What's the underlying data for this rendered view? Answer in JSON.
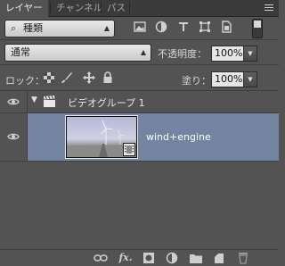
{
  "tabs": [
    {
      "label": "レイヤー",
      "active": true
    },
    {
      "label": "チャンネル",
      "active": false
    },
    {
      "label": "パス",
      "active": false
    }
  ],
  "filter": {
    "kind_label": "種類"
  },
  "blend": {
    "mode": "通常",
    "opacity_label": "不透明度：",
    "opacity_value": "100%"
  },
  "lock": {
    "label": "ロック：",
    "fill_label": "塗り：",
    "fill_value": "100%"
  },
  "layers": [
    {
      "type": "group",
      "name": "ビデオグループ 1",
      "visible": true,
      "expanded": true
    },
    {
      "type": "video",
      "name": "wind+engine",
      "visible": true,
      "selected": true
    }
  ],
  "colors": {
    "panel": "#535353",
    "selected_row": "#7385a1",
    "tabbar": "#3a3a3a"
  },
  "bottom_icons": [
    "link-layers-icon",
    "fx-icon",
    "layer-mask-icon",
    "adjustment-layer-icon",
    "new-group-icon",
    "new-layer-icon",
    "trash-icon"
  ]
}
